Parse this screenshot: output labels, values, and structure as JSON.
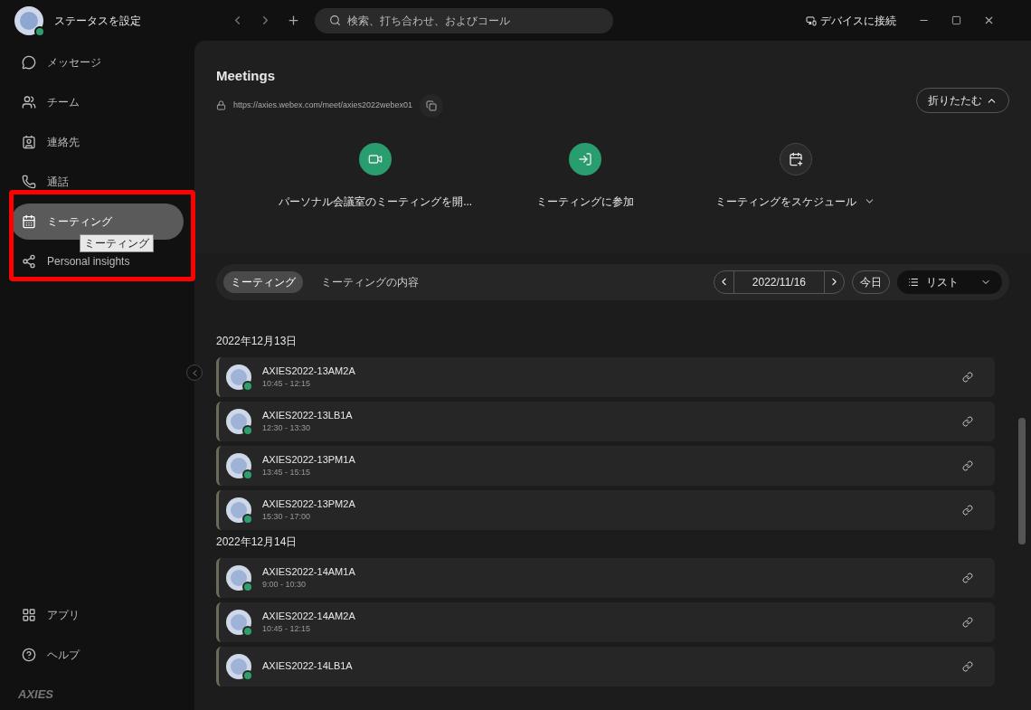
{
  "profile": {
    "status": "ステータスを設定"
  },
  "sidebar": {
    "items": [
      {
        "kind": "chat",
        "label": "メッセージ",
        "selected": false
      },
      {
        "kind": "team",
        "label": "チーム",
        "selected": false
      },
      {
        "kind": "contacts",
        "label": "連絡先",
        "selected": false
      },
      {
        "kind": "phone",
        "label": "通話",
        "selected": false
      },
      {
        "kind": "calendar",
        "label": "ミーティング",
        "selected": true,
        "tooltip": "ミーティング"
      },
      {
        "kind": "insights",
        "label": "Personal insights",
        "selected": false
      }
    ],
    "bottom_items": [
      {
        "kind": "apps",
        "label": "アプリ"
      },
      {
        "kind": "help",
        "label": "ヘルプ"
      }
    ],
    "logo": "AXIES"
  },
  "topbar": {
    "search": {
      "placeholder": "検索、打ち合わせ、およびコール"
    },
    "connect": "デバイスに接続"
  },
  "meetings": {
    "title": "Meetings",
    "url": "https://axies.webex.com/meet/axies2022webex01",
    "collapse": "折りたたむ",
    "actions": [
      {
        "kind": "start",
        "label": "パーソナル会議室のミーティングを開...",
        "accent": true
      },
      {
        "kind": "join",
        "label": "ミーティングに参加",
        "accent": true
      },
      {
        "kind": "schedule",
        "label": "ミーティングをスケジュール",
        "accent": false,
        "dropdown": true
      }
    ]
  },
  "toolbar": {
    "tabs": [
      {
        "label": "ミーティング",
        "selected": true
      },
      {
        "label": "ミーティングの内容",
        "selected": false
      }
    ],
    "date": "2022/11/16",
    "today": "今日",
    "view": "リスト"
  },
  "groups": [
    {
      "date": "2022年12月13日",
      "meetings": [
        {
          "title": "AXIES2022-13AM2A",
          "time": "10:45 - 12:15"
        },
        {
          "title": "AXIES2022-13LB1A",
          "time": "12:30 - 13:30"
        },
        {
          "title": "AXIES2022-13PM1A",
          "time": "13:45 - 15:15"
        },
        {
          "title": "AXIES2022-13PM2A",
          "time": "15:30 - 17:00"
        }
      ]
    },
    {
      "date": "2022年12月14日",
      "meetings": [
        {
          "title": "AXIES2022-14AM1A",
          "time": "9:00 - 10:30"
        },
        {
          "title": "AXIES2022-14AM2A",
          "time": "10:45 - 12:15"
        },
        {
          "title": "AXIES2022-14LB1A"
        }
      ]
    }
  ]
}
